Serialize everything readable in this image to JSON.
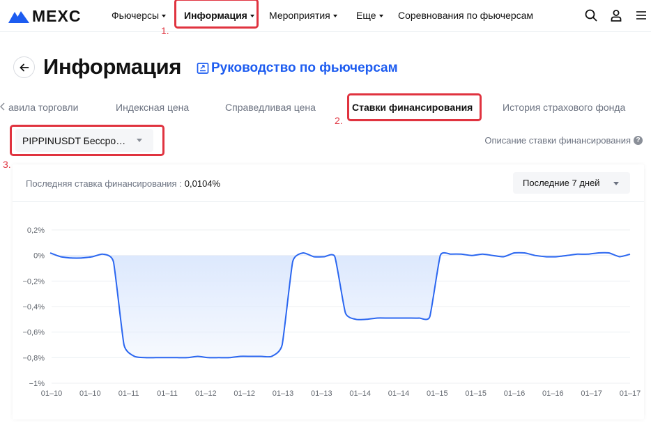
{
  "nav": {
    "logo_text": "MEXC",
    "items": [
      {
        "label": "Фьючерсы",
        "caret": true
      },
      {
        "label": "Информация",
        "caret": true,
        "active": true
      },
      {
        "label": "Мероприятия",
        "caret": true
      },
      {
        "label": "Еще",
        "caret": true
      },
      {
        "label": "Соревнования по фьючерсам",
        "caret": false
      }
    ],
    "icons": [
      "search-icon",
      "user-icon",
      "menu-icon"
    ]
  },
  "annotations": [
    "1.",
    "2.",
    "3."
  ],
  "header": {
    "title": "Информация",
    "guide_link": "Руководство по фьючерсам"
  },
  "tabs": [
    {
      "label": "авила торговли"
    },
    {
      "label": "Индексная цена"
    },
    {
      "label": "Справедливая цена"
    },
    {
      "label": "Ставки финансирования",
      "active": true
    },
    {
      "label": "История страхового фонда"
    }
  ],
  "selector": {
    "symbol": "PIPPINUSDT Бессро…",
    "description_link": "Описание ставки финансирования",
    "help_glyph": "?"
  },
  "card": {
    "last_rate_label": "Последняя ставка финансирования :",
    "last_rate_value": "0,0104%",
    "period": "Последние 7 дней"
  },
  "colors": {
    "accent": "#1d5cf0",
    "line": "#2a66f0",
    "fill": "#dce8fd",
    "annotation": "#e0333f"
  },
  "chart_data": {
    "type": "area",
    "y_ticks": [
      "0,2%",
      "0%",
      "−0,2%",
      "−0,4%",
      "−0,6%",
      "−0,8%",
      "−1%"
    ],
    "ylim": [
      -1.0,
      0.2
    ],
    "x_labels": [
      "01–10",
      "01–10",
      "01–11",
      "01–11",
      "01–12",
      "01–12",
      "01–13",
      "01–13",
      "01–14",
      "01–14",
      "01–15",
      "01–15",
      "01–16",
      "01–16",
      "01–17",
      "01–17"
    ],
    "series": [
      {
        "values": [
          0.02,
          -0.01,
          -0.02,
          -0.02,
          -0.01,
          0.01,
          -0.05,
          -0.7,
          -0.79,
          -0.8,
          -0.8,
          -0.8,
          -0.8,
          -0.8,
          -0.79,
          -0.8,
          -0.8,
          -0.8,
          -0.79,
          -0.79,
          -0.79,
          -0.79,
          -0.7,
          -0.05,
          0.02,
          -0.01,
          -0.01,
          -0.01,
          -0.45,
          -0.5,
          -0.5,
          -0.49,
          -0.49,
          -0.49,
          -0.49,
          -0.49,
          -0.48,
          0.0,
          0.01,
          0.01,
          0.0,
          0.01,
          0.0,
          -0.01,
          0.02,
          0.02,
          0.0,
          -0.01,
          -0.01,
          0.0,
          0.01,
          0.01,
          0.02,
          0.02,
          -0.01,
          0.01
        ]
      }
    ]
  }
}
